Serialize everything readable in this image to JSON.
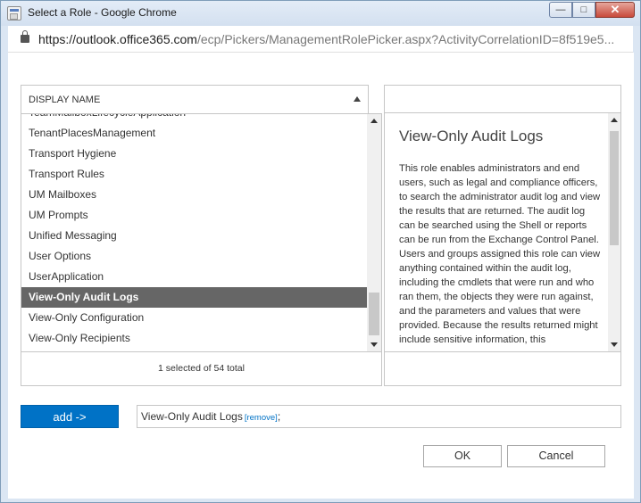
{
  "window": {
    "title": "Select a Role - Google Chrome",
    "url_main": "https://outlook.office365.com",
    "url_rest": "/ecp/Pickers/ManagementRolePicker.aspx?ActivityCorrelationID=8f519e5..."
  },
  "list": {
    "header": "DISPLAY NAME",
    "items": [
      "TeamMailboxLifecycleApplication",
      "TenantPlacesManagement",
      "Transport Hygiene",
      "Transport Rules",
      "UM Mailboxes",
      "UM Prompts",
      "Unified Messaging",
      "User Options",
      "UserApplication",
      "View-Only Audit Logs",
      "View-Only Configuration",
      "View-Only Recipients"
    ],
    "selected_index": 9,
    "status": "1 selected of 54 total"
  },
  "detail": {
    "title": "View-Only Audit Logs",
    "description": "This role enables administrators and end users, such as legal and compliance officers, to search the administrator audit log and view the results that are returned. The audit log can be searched using the Shell or reports can be run from the Exchange Control Panel. Users and groups assigned this role can view anything contained within the audit log, including the cmdlets that were run and who ran them, the objects they were run against, and the parameters and values that were provided. Because the results returned might include sensitive information, this"
  },
  "add": {
    "button_label": "add ->",
    "selected_value": "View-Only Audit Logs",
    "remove_label": "[remove]",
    "separator": ";"
  },
  "buttons": {
    "ok": "OK",
    "cancel": "Cancel"
  },
  "colors": {
    "accent": "#0072c6",
    "selected_row": "#666666"
  }
}
